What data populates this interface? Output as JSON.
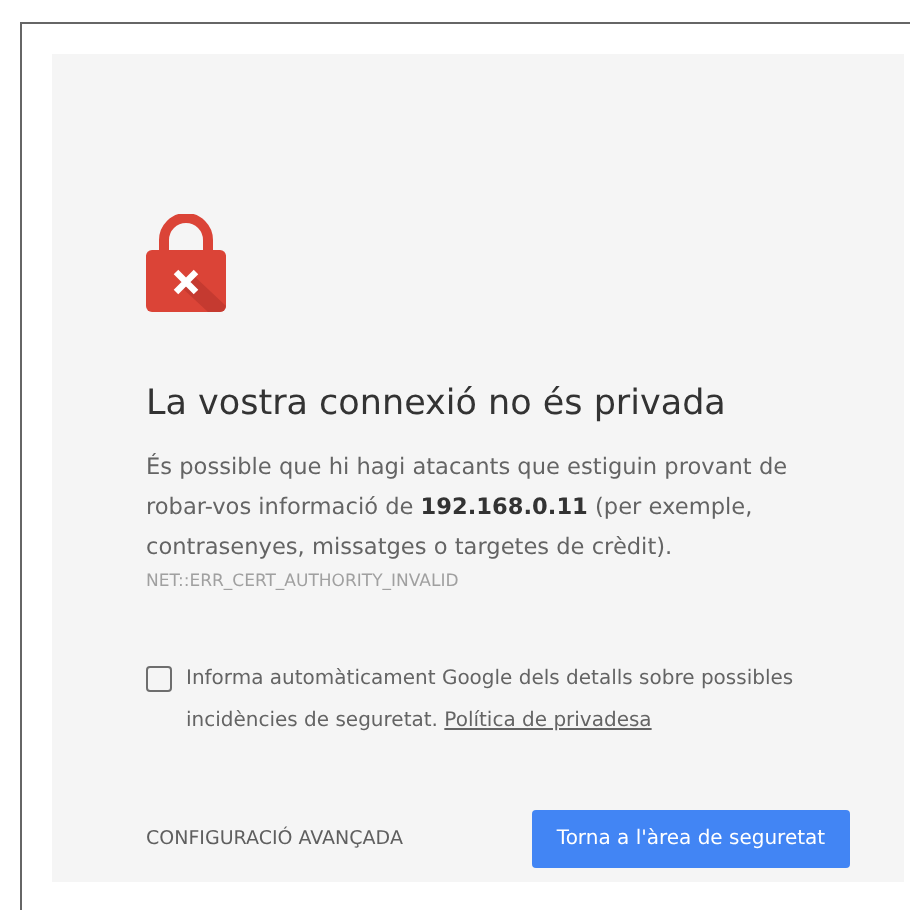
{
  "title": "La vostra connexió no és privada",
  "message": "És possible que hi hagi atacants que estiguin provant de robar-vos informació de **192.168.0.11** (per exemple, contrasenyes, missatges o targetes de crèdit).",
  "error_code": "NET::ERR_CERT_AUTHORITY_INVALID",
  "report": {
    "checked": false,
    "text": "Informa automàticament Google dels detalls sobre possibles incidències de seguretat.",
    "link": "Política de privadesa"
  },
  "advanced_button": "CONFIGURACIÓ AVANÇADA",
  "back_button": "Torna a l'àrea de seguretat"
}
